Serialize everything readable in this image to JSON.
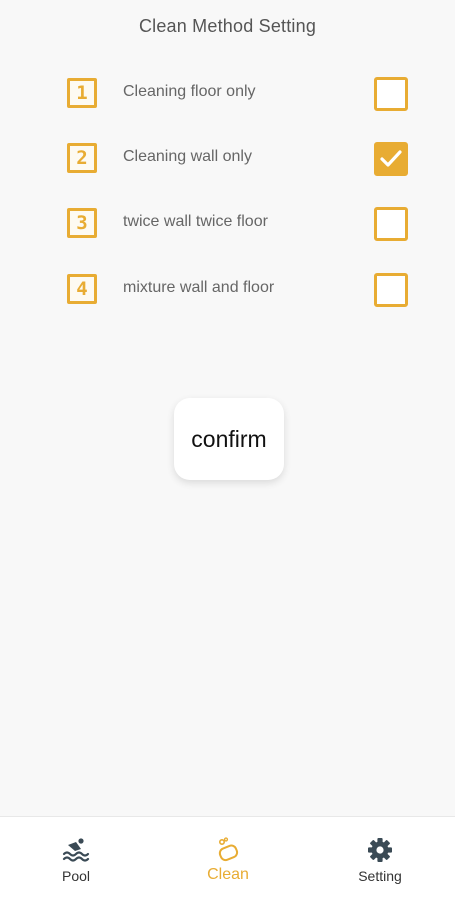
{
  "header": {
    "title": "Clean Method Setting"
  },
  "options": [
    {
      "number": "1",
      "label": "Cleaning floor only",
      "checked": false
    },
    {
      "number": "2",
      "label": "Cleaning wall only",
      "checked": true
    },
    {
      "number": "3",
      "label": "twice wall twice floor",
      "checked": false
    },
    {
      "number": "4",
      "label": "mixture wall and floor",
      "checked": false
    }
  ],
  "confirm": {
    "label": "confirm"
  },
  "nav": {
    "items": [
      {
        "label": "Pool",
        "icon": "swimmer-icon",
        "active": false
      },
      {
        "label": "Clean",
        "icon": "sponge-icon",
        "active": true
      },
      {
        "label": "Setting",
        "icon": "gear-icon",
        "active": false
      }
    ]
  },
  "colors": {
    "accent": "#e8ac33",
    "background": "#f8f8f8",
    "text": "#666666"
  }
}
